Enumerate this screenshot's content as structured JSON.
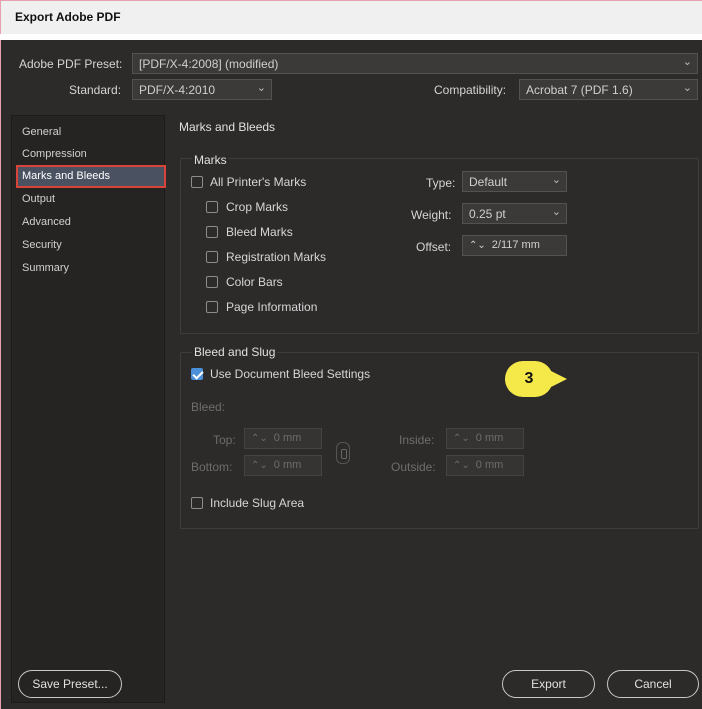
{
  "window": {
    "title": "Export Adobe PDF"
  },
  "preset": {
    "label": "Adobe PDF Preset:",
    "value": "[PDF/X-4:2008] (modified)"
  },
  "standard": {
    "label": "Standard:",
    "value": "PDF/X-4:2010"
  },
  "compatibility": {
    "label": "Compatibility:",
    "value": "Acrobat 7 (PDF 1.6)"
  },
  "sidebar": {
    "items": [
      {
        "label": "General"
      },
      {
        "label": "Compression"
      },
      {
        "label": "Marks and Bleeds"
      },
      {
        "label": "Output"
      },
      {
        "label": "Advanced"
      },
      {
        "label": "Security"
      },
      {
        "label": "Summary"
      }
    ],
    "selected": "Marks and Bleeds"
  },
  "panel": {
    "title": "Marks and Bleeds"
  },
  "marks": {
    "title": "Marks",
    "all_printers_marks": "All Printer's Marks",
    "crop_marks": "Crop Marks",
    "bleed_marks": "Bleed Marks",
    "registration_marks": "Registration Marks",
    "color_bars": "Color Bars",
    "page_information": "Page Information",
    "type_label": "Type:",
    "type_value": "Default",
    "weight_label": "Weight:",
    "weight_value": "0.25 pt",
    "offset_label": "Offset:",
    "offset_value": "2/117 mm"
  },
  "bleed": {
    "title": "Bleed and Slug",
    "use_document_bleed": "Use Document Bleed Settings",
    "bleed_label": "Bleed:",
    "top_label": "Top:",
    "top_value": "0 mm",
    "bottom_label": "Bottom:",
    "bottom_value": "0 mm",
    "inside_label": "Inside:",
    "inside_value": "0 mm",
    "outside_label": "Outside:",
    "outside_value": "0 mm",
    "include_slug": "Include Slug Area"
  },
  "callout": {
    "number": "3"
  },
  "buttons": {
    "save_preset": "Save Preset...",
    "export": "Export",
    "cancel": "Cancel"
  },
  "colors": {
    "selection": "#4a5161",
    "selection_outline": "#d9443a",
    "callout": "#f5e94a",
    "checkbox_checked": "#4a8fd8"
  }
}
